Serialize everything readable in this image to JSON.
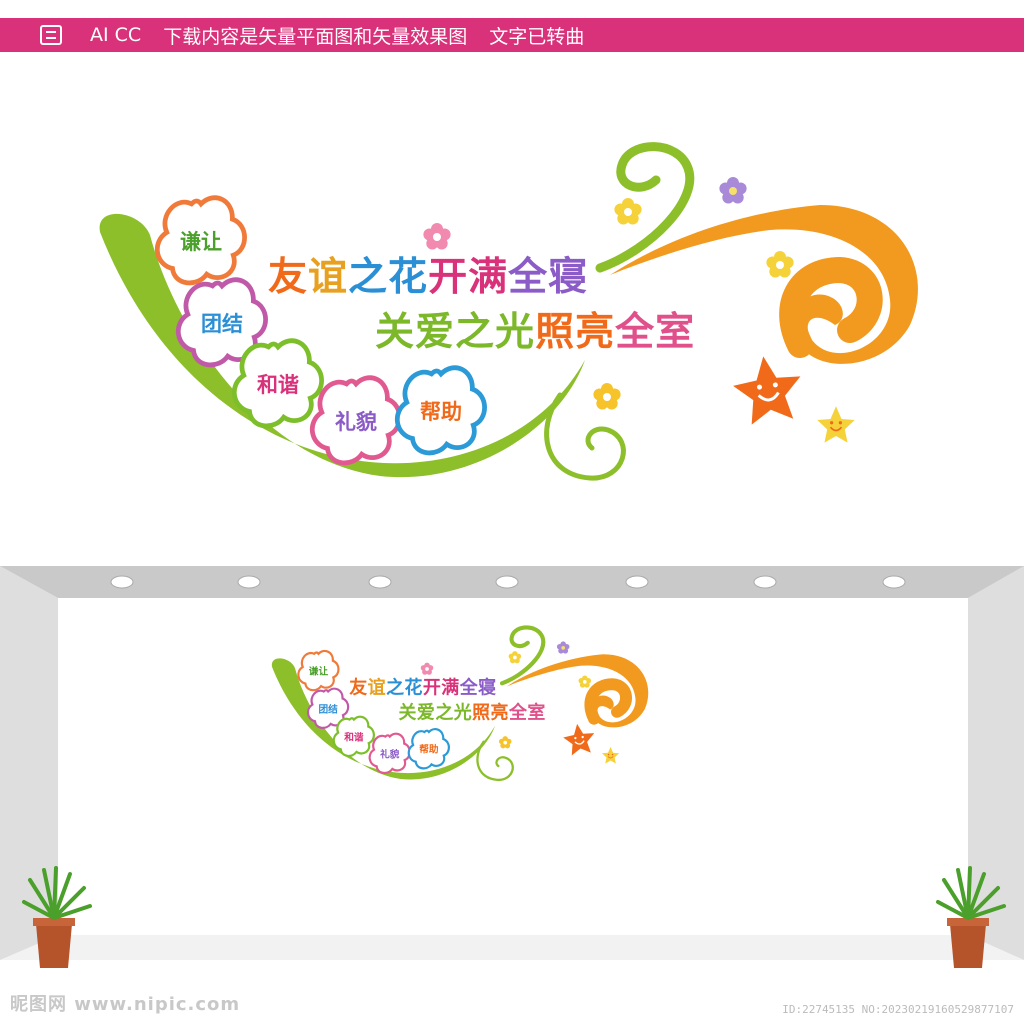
{
  "topbar": {
    "software": "AI CC",
    "notice": "下载内容是矢量平面图和矢量效果图",
    "text_note": "文字已转曲"
  },
  "design": {
    "headline1": [
      "友",
      "谊",
      "之",
      "花",
      "开",
      "满",
      "全",
      "寝"
    ],
    "headline2": [
      "关",
      "爱",
      "之",
      "光",
      "照",
      "亮",
      "全",
      "室"
    ],
    "badges": [
      "谦让",
      "团结",
      "和谐",
      "礼貌",
      "帮助"
    ]
  },
  "footer": {
    "site": "昵图网 www.nipic.com",
    "id": "ID:22745135 NO:20230219160529877107"
  },
  "colors": {
    "brand": "#d9327a",
    "green": "#8cbf2a",
    "orange": "#f29a1f",
    "red_orange": "#f06a1a",
    "blue": "#2b8fd6",
    "purple": "#8b5cc8",
    "pink": "#e0508a"
  }
}
